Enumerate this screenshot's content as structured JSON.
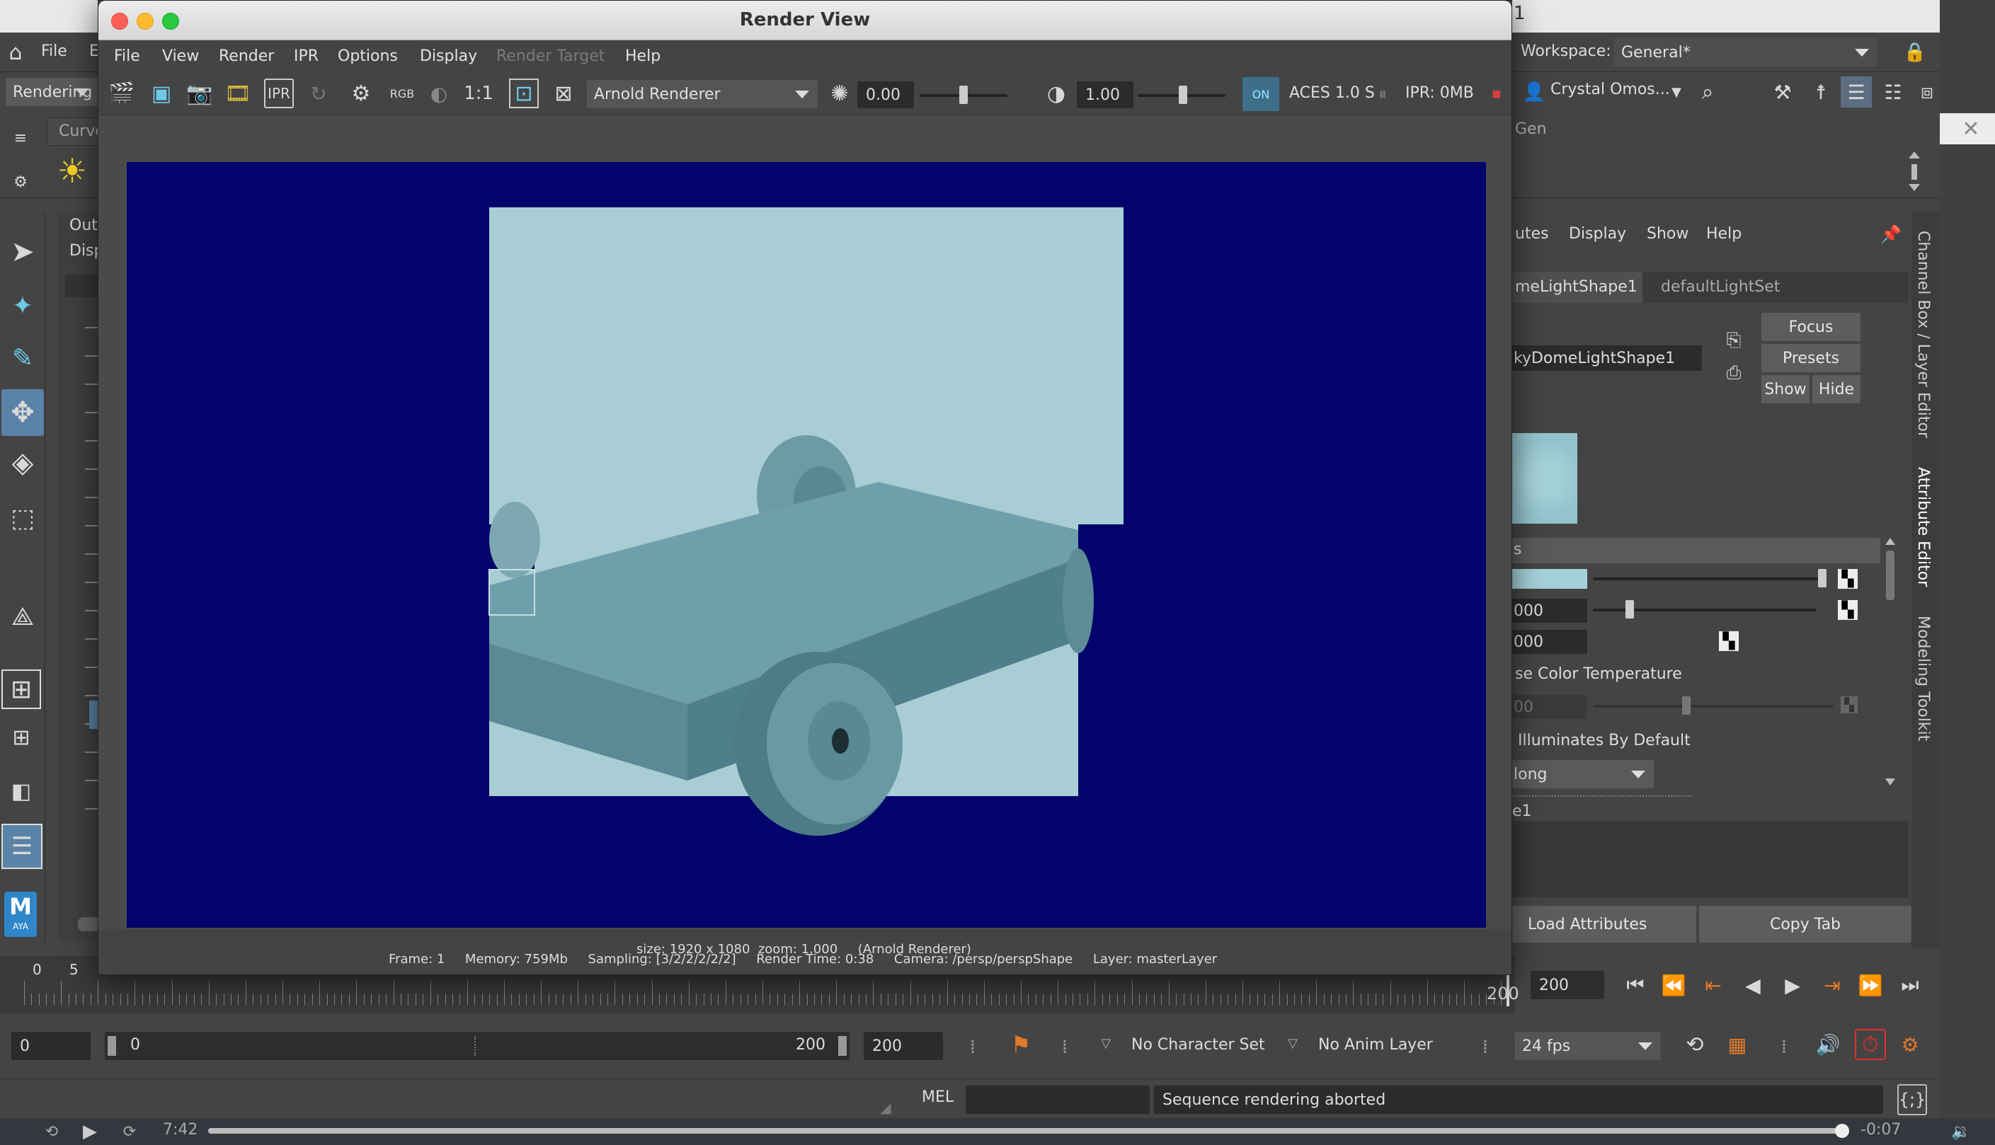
{
  "window": {
    "title": "Render View"
  },
  "menu": [
    "File",
    "View",
    "Render",
    "IPR",
    "Options",
    "Display",
    "Render Target",
    "Help"
  ],
  "toolbar": {
    "ratio_label": "1:1",
    "rgb_label": "RGB",
    "renderer": "Arnold Renderer",
    "exposure": "0.00",
    "gamma": "1.00",
    "view_transform": "ACES 1.0 S",
    "ipr_memory": "IPR: 0MB"
  },
  "status_line1": "size: 1920 x 1080  zoom: 1.000     (Arnold Renderer)",
  "status_line2": "Frame: 1     Memory: 759Mb     Sampling: [3/2/2/2/2/2]     Render Time: 0:38     Camera: /persp/perspShape     Layer: masterLayer",
  "maya": {
    "menuset": "Rendering",
    "shelf_tab": "Curve",
    "outliner_label": "Out",
    "outliner_sub": "Disp",
    "maya_logo": "M",
    "maya_logo_sub": "AYA",
    "title_fragment": "1",
    "workspace_label": "Workspace:",
    "workspace_value": "General*",
    "user_name": "Crystal Omos...",
    "shelf_right_tab": "Gen"
  },
  "attr_editor": {
    "menu": [
      "utes",
      "Display",
      "Show",
      "Help"
    ],
    "tabs": [
      "meLightShape1",
      "defaultLightSet"
    ],
    "node_name": "kyDomeLightShape1",
    "buttons": {
      "focus": "Focus",
      "presets": "Presets",
      "show": "Show",
      "hide": "Hide"
    },
    "section_label": "s",
    "field1": "000",
    "field2": "000",
    "color_temp_label": "se Color Temperature",
    "color_temp_value": "00",
    "illuminates_label": "Illuminates By Default",
    "format_value": "long",
    "notes_label": "e1",
    "load_attributes": "Load Attributes",
    "copy_tab": "Copy Tab"
  },
  "side_tabs": [
    "Channel Box / Layer Editor",
    "Attribute Editor",
    "Modeling Toolkit"
  ],
  "timeline": {
    "tick_start": "0",
    "tick_5": "5",
    "tick_end": "200",
    "current_frame": "200",
    "range_start": "0",
    "range_inner_start": "0",
    "range_inner_end": "200",
    "range_end": "200",
    "character_set": "No Character Set",
    "anim_layer": "No Anim Layer",
    "fps": "24 fps"
  },
  "command_line": {
    "mode": "MEL",
    "feedback": "Sequence rendering aborted"
  },
  "video": {
    "elapsed": "7:42",
    "remaining": "-0:07",
    "skip_back": "15",
    "skip_fwd": "15"
  }
}
